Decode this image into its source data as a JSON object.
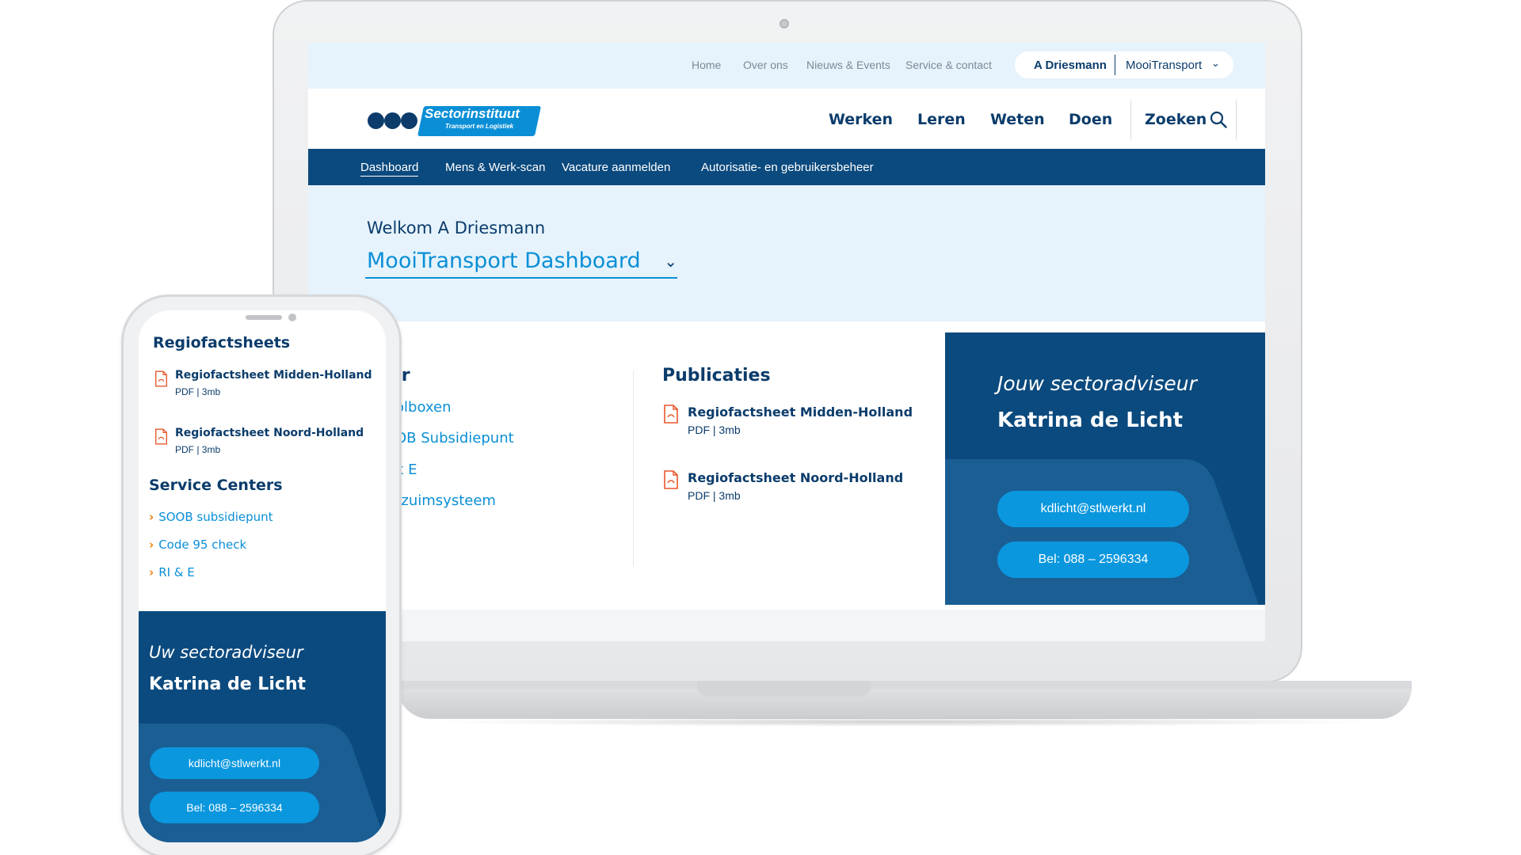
{
  "utility_nav": {
    "links": [
      "Home",
      "Over ons",
      "Nieuws & Events",
      "Service & contact"
    ],
    "account_user": "A Driesmann",
    "account_org": "MooiTransport"
  },
  "brand": {
    "name": "Sectorinstituut",
    "tagline": "Transport en Logistiek"
  },
  "main_nav": {
    "items": [
      "Werken",
      "Leren",
      "Weten",
      "Doen"
    ],
    "search_label": "Zoeken"
  },
  "sub_nav": {
    "items": [
      "Dashboard",
      "Mens & Werk-scan",
      "Vacature aanmelden",
      "Autorisatie- en gebruikersbeheer"
    ],
    "active": "Dashboard"
  },
  "hero": {
    "welcome": "Welkom A Driesmann",
    "dashboard_title": "MooiTransport Dashboard"
  },
  "left_column": {
    "heading_visible": "aar",
    "links": [
      "olboxen",
      "OB Subsidiepunt",
      "k E",
      "rzuimsysteem"
    ]
  },
  "publications": {
    "heading": "Publicaties",
    "files": [
      {
        "name": "Regiofactsheet Midden-Holland",
        "meta": "PDF | 3mb"
      },
      {
        "name": "Regiofactsheet Noord-Holland",
        "meta": "PDF | 3mb"
      }
    ]
  },
  "advisor_desktop": {
    "label": "Jouw sectoradviseur",
    "name": "Katrina de Licht",
    "email": "kdlicht@stlwerkt.nl",
    "phone": "Bel: 088 – 2596334"
  },
  "phone": {
    "factsheets_heading": "Regiofactsheets",
    "files": [
      {
        "name": "Regiofactsheet Midden-Holland",
        "meta": "PDF | 3mb"
      },
      {
        "name": "Regiofactsheet Noord-Holland",
        "meta": "PDF | 3mb"
      }
    ],
    "service_heading": "Service Centers",
    "service_links": [
      "SOOB subsidiepunt",
      "Code 95 check",
      "RI & E"
    ],
    "advisor_label": "Uw sectoradviseur",
    "advisor_name": "Katrina de Licht",
    "email": "kdlicht@stlwerkt.nl",
    "phone": "Bel: 088 – 2596334"
  },
  "colors": {
    "navy": "#0b3c6b",
    "subnav_blue": "#0b4a7e",
    "accent_blue": "#0a8fd6",
    "hero_bg": "#e6f3fc",
    "arrow_orange": "#f07c00",
    "pdf_red": "#e8572a"
  },
  "icons": [
    "search-icon",
    "chevron-down-icon",
    "pdf-file-icon",
    "chevron-right-icon"
  ]
}
